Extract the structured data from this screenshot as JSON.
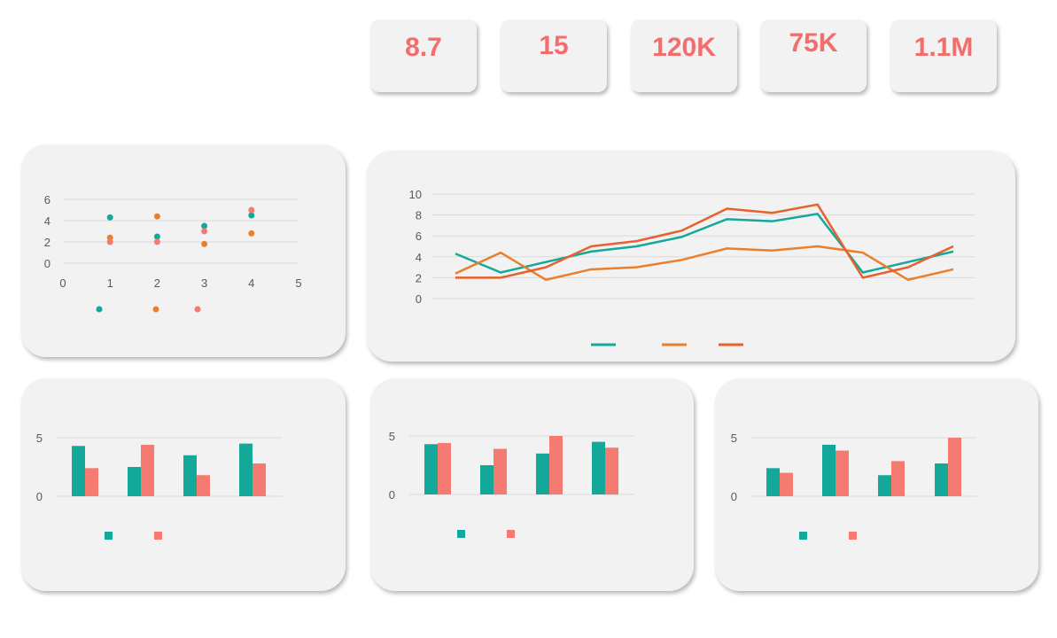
{
  "colors": {
    "teal": "#14a89a",
    "orange": "#ea7f2e",
    "coral": "#f47a72",
    "redorange": "#e8602d",
    "kpi_text": "#f46d6d"
  },
  "kpis": [
    {
      "value": "8.7"
    },
    {
      "value": "15"
    },
    {
      "value": "120K"
    },
    {
      "value": "75K"
    },
    {
      "value": "1.1M"
    }
  ],
  "chart_data": [
    {
      "type": "scatter",
      "xlim": [
        0,
        5
      ],
      "ylim": [
        0,
        6
      ],
      "xticks": [
        "0",
        "1",
        "2",
        "3",
        "4",
        "5"
      ],
      "yticks": [
        "0",
        "2",
        "4",
        "6"
      ],
      "grid": true,
      "legend": "bottom",
      "series": [
        {
          "color": "#14a89a",
          "points": [
            [
              1,
              4.3
            ],
            [
              2,
              2.5
            ],
            [
              3,
              3.5
            ],
            [
              4,
              4.5
            ]
          ]
        },
        {
          "color": "#ea7f2e",
          "points": [
            [
              1,
              2.4
            ],
            [
              2,
              4.4
            ],
            [
              3,
              1.8
            ],
            [
              4,
              2.8
            ]
          ]
        },
        {
          "color": "#f47a72",
          "points": [
            [
              1,
              2.0
            ],
            [
              2,
              2.0
            ],
            [
              3,
              3.0
            ],
            [
              4,
              5.0
            ]
          ]
        }
      ]
    },
    {
      "type": "line",
      "ylim": [
        0,
        10
      ],
      "yticks": [
        "0",
        "2",
        "4",
        "6",
        "8",
        "10"
      ],
      "points_per_series": 12,
      "grid": true,
      "legend": "bottom",
      "series": [
        {
          "color": "#14a89a",
          "values": [
            4.3,
            2.5,
            3.5,
            4.5,
            5.0,
            5.9,
            7.6,
            7.4,
            8.1,
            2.5,
            3.5,
            4.5
          ]
        },
        {
          "color": "#ea7f2e",
          "values": [
            2.4,
            4.4,
            1.8,
            2.8,
            3.0,
            3.7,
            4.8,
            4.6,
            5.0,
            4.4,
            1.8,
            2.8
          ]
        },
        {
          "color": "#e8602d",
          "values": [
            2.0,
            2.0,
            3.0,
            5.0,
            5.5,
            6.5,
            8.6,
            8.2,
            9.0,
            2.0,
            3.0,
            5.0
          ]
        }
      ]
    },
    {
      "type": "bar",
      "ylim": [
        0,
        5
      ],
      "yticks": [
        "0",
        "5"
      ],
      "grid": true,
      "legend": "bottom",
      "series": [
        {
          "color": "#14a89a",
          "values": [
            4.3,
            2.5,
            3.5,
            4.5
          ]
        },
        {
          "color": "#f47a72",
          "values": [
            2.4,
            4.4,
            1.8,
            2.8
          ]
        }
      ]
    },
    {
      "type": "bar",
      "ylim": [
        0,
        5
      ],
      "yticks": [
        "0",
        "5"
      ],
      "grid": true,
      "legend": "bottom",
      "series": [
        {
          "color": "#14a89a",
          "values": [
            4.3,
            2.5,
            3.5,
            4.5
          ]
        },
        {
          "color": "#f47a72",
          "values": [
            4.4,
            3.9,
            5.0,
            4.0
          ]
        }
      ]
    },
    {
      "type": "bar",
      "ylim": [
        0,
        5
      ],
      "yticks": [
        "0",
        "5"
      ],
      "grid": true,
      "legend": "bottom",
      "series": [
        {
          "color": "#14a89a",
          "values": [
            2.4,
            4.4,
            1.8,
            2.8
          ]
        },
        {
          "color": "#f47a72",
          "values": [
            2.0,
            3.9,
            3.0,
            5.0
          ]
        }
      ]
    }
  ]
}
